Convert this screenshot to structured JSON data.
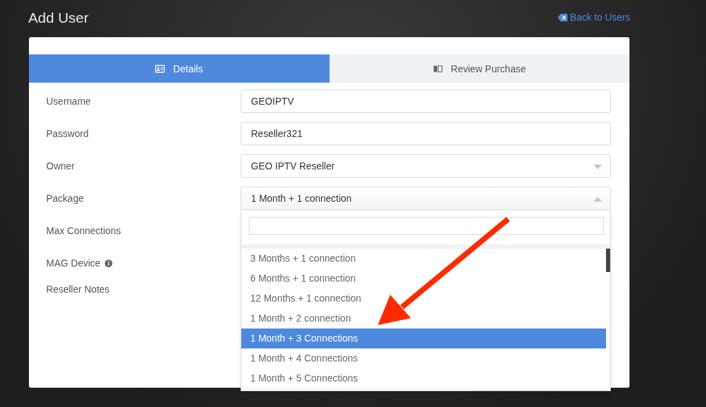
{
  "page": {
    "title": "Add User",
    "back_link": "Back to Users"
  },
  "tabs": [
    {
      "label": "Details",
      "selected": true
    },
    {
      "label": "Review Purchase",
      "selected": false
    }
  ],
  "form": [
    {
      "label": "Username",
      "kind": "input",
      "value": "GEOIPTV"
    },
    {
      "label": "Password",
      "kind": "input",
      "value": "Reseller321"
    },
    {
      "label": "Owner",
      "kind": "select",
      "value": "GEO IPTV Reseller",
      "expanded": false
    },
    {
      "label": "Package",
      "kind": "select",
      "value": "1 Month + 1 connection",
      "expanded": true,
      "options": [
        {
          "label": "3 Months + 1 connection",
          "selected": false
        },
        {
          "label": "6 Months + 1 connection",
          "selected": false
        },
        {
          "label": "12 Months + 1 connection",
          "selected": false
        },
        {
          "label": "1 Month + 2 connection",
          "selected": false
        },
        {
          "label": "1 Month + 3 Connections",
          "selected": true
        },
        {
          "label": "1 Month + 4 Connections",
          "selected": false
        },
        {
          "label": "1 Month + 5 Connections",
          "selected": false
        }
      ]
    },
    {
      "label": "Max Connections",
      "kind": "hidden"
    },
    {
      "label": "MAG Device",
      "kind": "hidden",
      "info": true
    },
    {
      "label": "Reseller Notes",
      "kind": "hidden"
    }
  ]
}
